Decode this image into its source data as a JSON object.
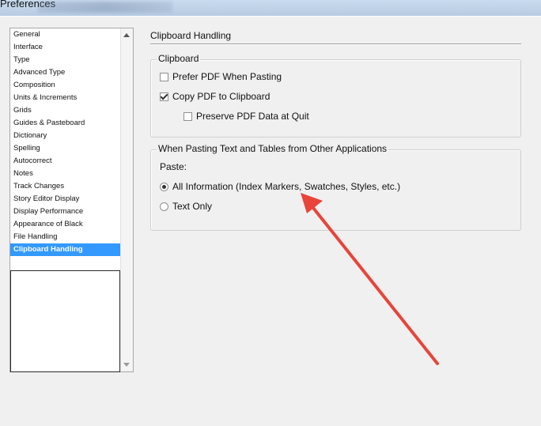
{
  "window": {
    "title": "Preferences"
  },
  "sidebar": {
    "items": [
      {
        "label": "General"
      },
      {
        "label": "Interface"
      },
      {
        "label": "Type"
      },
      {
        "label": "Advanced Type"
      },
      {
        "label": "Composition"
      },
      {
        "label": "Units & Increments"
      },
      {
        "label": "Grids"
      },
      {
        "label": "Guides & Pasteboard"
      },
      {
        "label": "Dictionary"
      },
      {
        "label": "Spelling"
      },
      {
        "label": "Autocorrect"
      },
      {
        "label": "Notes"
      },
      {
        "label": "Track Changes"
      },
      {
        "label": "Story Editor Display"
      },
      {
        "label": "Display Performance"
      },
      {
        "label": "Appearance of Black"
      },
      {
        "label": "File Handling"
      },
      {
        "label": "Clipboard Handling"
      }
    ],
    "selected": "Clipboard Handling"
  },
  "panel": {
    "title": "Clipboard Handling",
    "clipboard_group": {
      "legend": "Clipboard",
      "prefer_pdf": {
        "label": "Prefer PDF When Pasting",
        "checked": false
      },
      "copy_pdf": {
        "label": "Copy PDF to Clipboard",
        "checked": true
      },
      "preserve_pdf": {
        "label": "Preserve PDF Data at Quit",
        "checked": false
      }
    },
    "pasting_group": {
      "legend": "When Pasting Text and Tables from Other Applications",
      "paste_label": "Paste:",
      "all_information": {
        "label": "All Information (Index Markers, Swatches, Styles, etc.)",
        "selected": true
      },
      "text_only": {
        "label": "Text Only",
        "selected": false
      }
    }
  },
  "annotation": {
    "arrow_color": "#e8443a"
  },
  "icons": {
    "scroll_up": "chevron-up-icon",
    "scroll_down": "chevron-down-icon"
  }
}
